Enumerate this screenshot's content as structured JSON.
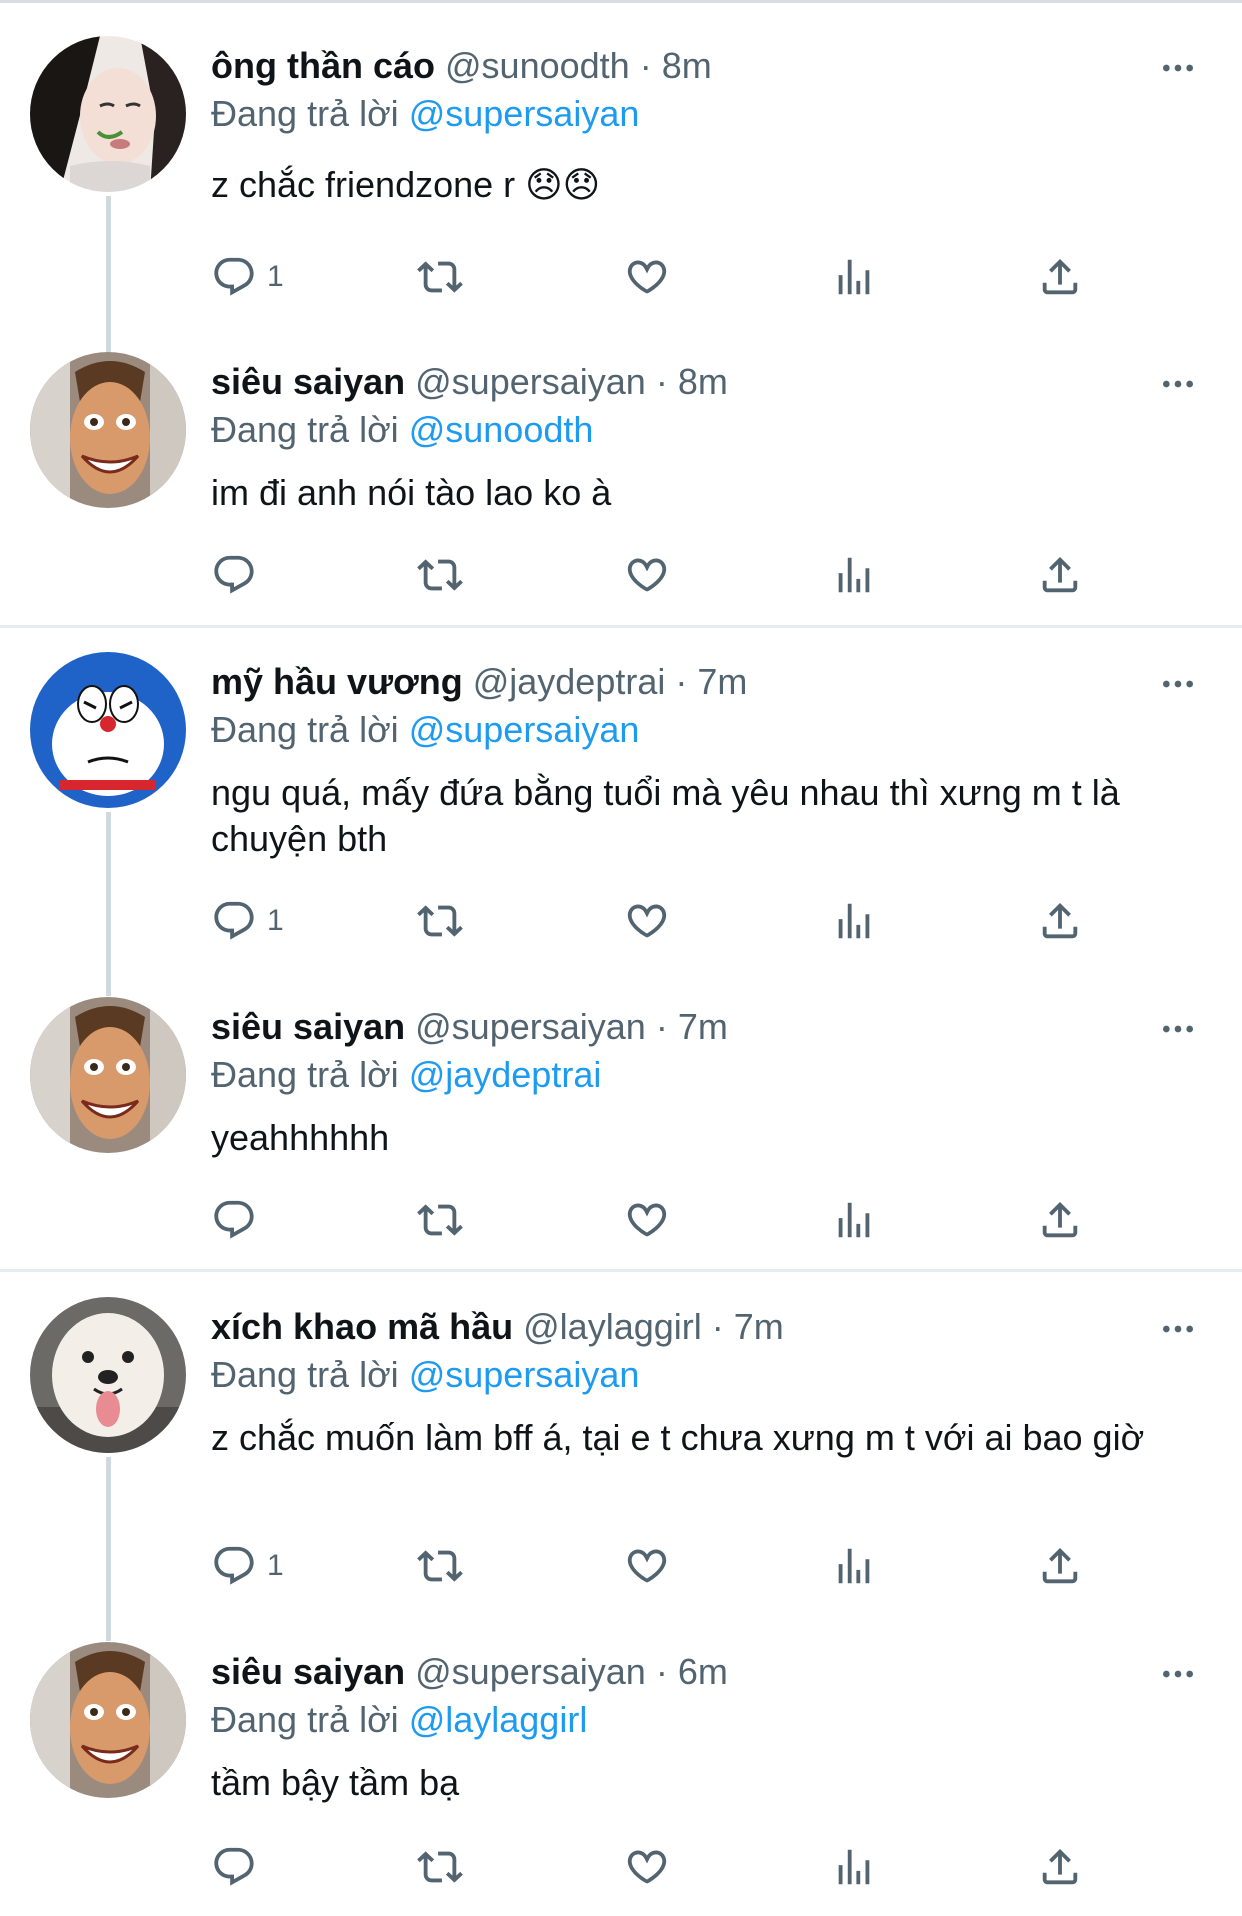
{
  "reply_prefix": "Đang trả lời",
  "tweets": [
    {
      "name": "ông thần cáo",
      "handle": "@sunoodth",
      "dot": "·",
      "time": "8m",
      "reply_to": "@supersaiyan",
      "text": "z chắc friendzone r 😞😞",
      "reply_count": "1"
    },
    {
      "name": "siêu saiyan",
      "handle": "@supersaiyan",
      "dot": "·",
      "time": "8m",
      "reply_to": "@sunoodth",
      "text": "im đi anh nói tào lao ko à",
      "reply_count": ""
    },
    {
      "name": "mỹ hầu vương",
      "handle": "@jaydeptrai",
      "dot": "·",
      "time": "7m",
      "reply_to": "@supersaiyan",
      "text": "ngu quá, mấy đứa bằng tuổi mà yêu nhau thì xưng m t là chuyện bth",
      "reply_count": "1"
    },
    {
      "name": "siêu saiyan",
      "handle": "@supersaiyan",
      "dot": "·",
      "time": "7m",
      "reply_to": "@jaydeptrai",
      "text": "yeahhhhhh",
      "reply_count": ""
    },
    {
      "name": "xích khao mã hầu",
      "handle": "@laylaggirl",
      "dot": "·",
      "time": "7m",
      "reply_to": "@supersaiyan",
      "text": "z chắc muốn làm bff á, tại e t chưa xưng m t với ai bao giờ",
      "reply_count": "1"
    },
    {
      "name": "siêu saiyan",
      "handle": "@supersaiyan",
      "dot": "·",
      "time": "6m",
      "reply_to": "@laylaggirl",
      "text": "tầm bậy tầm bạ",
      "reply_count": ""
    }
  ],
  "icons": {
    "reply": "reply-icon",
    "retweet": "retweet-icon",
    "like": "heart-icon",
    "views": "analytics-icon",
    "share": "share-icon",
    "more": "more-icon"
  },
  "colors": {
    "accent": "#1d9bf0",
    "muted": "#536471",
    "text": "#0f1419",
    "divider": "#e6ecf0",
    "thread": "#cfd9de"
  }
}
